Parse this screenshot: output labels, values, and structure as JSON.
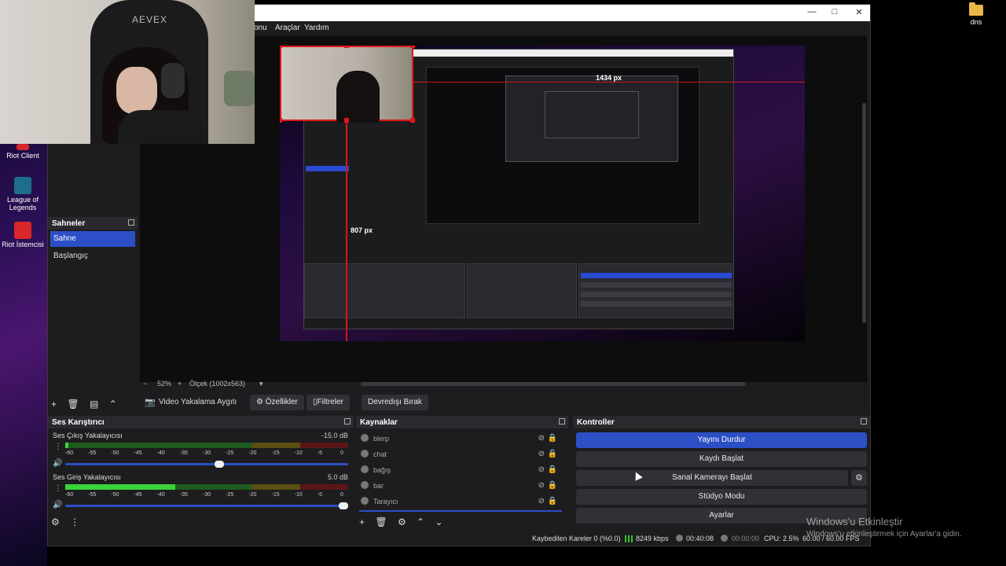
{
  "desktop": {
    "icons": [
      {
        "label": "Riot Client"
      },
      {
        "label": "League of Legends"
      },
      {
        "label": "Riot İstemcisi"
      }
    ],
    "folder": {
      "label": "dns"
    },
    "activation": {
      "title": "Windows'u Etkinleştir",
      "subtitle": "Windows'u etkinleştirmek için Ayarlar'a gidin."
    }
  },
  "webcam": {
    "chair_brand": "AEVEX"
  },
  "window": {
    "menu": [
      "onu",
      "Araçlar",
      "Yardım"
    ],
    "controls": {
      "minimize": "—",
      "maximize": "□",
      "close": "✕"
    }
  },
  "preview": {
    "zoom": "52%",
    "scale_label": "Ölçek (1002x563)",
    "width_px_label": "1434 px",
    "height_px_label": "807 px"
  },
  "scenes": {
    "title": "Sahneler",
    "items": [
      "Sahne",
      "Başlangıç"
    ],
    "active_index": 0
  },
  "source_bar": {
    "source_name": "Video Yakalama Aygıtı",
    "properties": "Özellikler",
    "filters": "Filtreler",
    "deactivate": "Devredışı Bırak"
  },
  "mixer": {
    "title": "Ses Karıştırıcı",
    "tracks": [
      {
        "name": "Ses Çıkış Yakalayıcısı",
        "db": "-15.0 dB",
        "level": 0.01,
        "volume": 0.56
      },
      {
        "name": "Ses Giriş Yakalayıcısı",
        "db": "5.0 dB",
        "level": 0.39,
        "volume": 1.0
      }
    ],
    "ticks": [
      "-60",
      "-55",
      "-50",
      "-45",
      "-40",
      "-35",
      "-30",
      "-25",
      "-20",
      "-15",
      "-10",
      "-5",
      "0"
    ]
  },
  "sources": {
    "title": "Kaynaklar",
    "items": [
      "blerp",
      "chat",
      "bağış",
      "bar",
      "Tarayıcı"
    ]
  },
  "controls": {
    "title": "Kontroller",
    "stop_stream": "Yayını Durdur",
    "start_record": "Kaydı Başlat",
    "start_virtual_cam": "Sanal Kamerayı Başlat",
    "studio_mode": "Stüdyo Modu",
    "settings": "Ayarlar"
  },
  "status": {
    "dropped": "Kaybedilen Kareler 0 (%0.0)",
    "bitrate": "8249 kbps",
    "stream_time": "00:40:08",
    "rec_time": "00:00:00",
    "cpu": "CPU: 2.5%",
    "fps": "60.00 / 60.00 FPS"
  },
  "colors": {
    "accent": "#2c4fc6",
    "meter_green": "#3ad43a",
    "red_guide": "#d31818"
  }
}
